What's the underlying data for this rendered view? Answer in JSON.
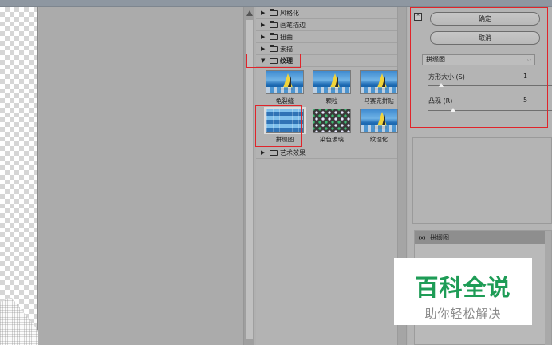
{
  "filter_gallery": {
    "categories_top": [
      {
        "label": "风格化",
        "expanded": false
      },
      {
        "label": "画笔描边",
        "expanded": false
      },
      {
        "label": "扭曲",
        "expanded": false
      },
      {
        "label": "素描",
        "expanded": false
      }
    ],
    "open_category": {
      "label": "纹理",
      "expanded": true
    },
    "texture_filters": [
      {
        "label": "龟裂缝",
        "selected": false
      },
      {
        "label": "颗粒",
        "selected": false
      },
      {
        "label": "马赛克拼贴",
        "selected": false
      },
      {
        "label": "拼缀图",
        "selected": true
      },
      {
        "label": "染色玻璃",
        "selected": false
      },
      {
        "label": "纹理化",
        "selected": false
      }
    ],
    "categories_bottom": [
      {
        "label": "艺术效果",
        "expanded": false
      }
    ]
  },
  "settings": {
    "ok_label": "确定",
    "cancel_label": "取消",
    "filter_select": "拼缀图",
    "params": [
      {
        "label": "方形大小 (S)",
        "value": "1",
        "level": 0.1
      },
      {
        "label": "凸现 (R)",
        "value": "5",
        "level": 0.2
      }
    ]
  },
  "layers": {
    "items": [
      {
        "label": "拼缀图",
        "visible": true
      }
    ]
  },
  "watermark": {
    "title": "百科全说",
    "subtitle": "助你轻松解决"
  }
}
